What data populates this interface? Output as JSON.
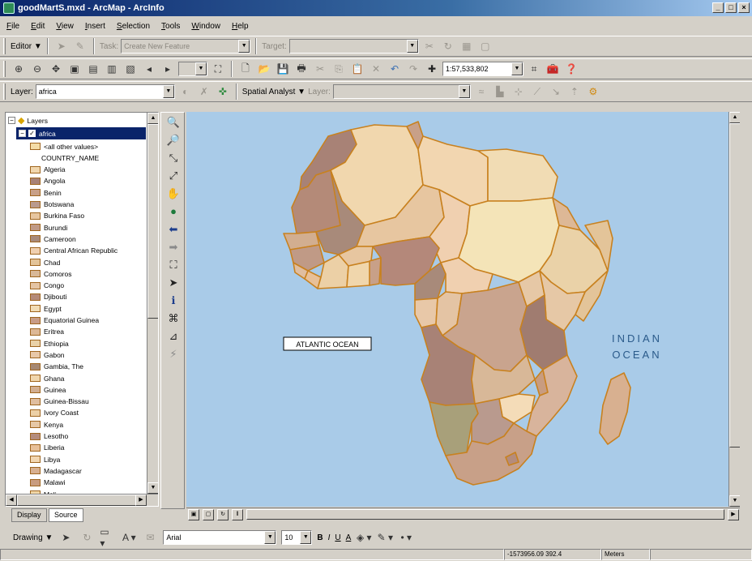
{
  "window": {
    "title": "goodMartS.mxd - ArcMap - ArcInfo",
    "controls": [
      "_",
      "□",
      "×"
    ]
  },
  "menu": [
    "File",
    "Edit",
    "View",
    "Insert",
    "Selection",
    "Tools",
    "Window",
    "Help"
  ],
  "editor_toolbar": {
    "editor_label": "Editor ▼",
    "task_label": "Task:",
    "task_value": "Create New Feature",
    "target_label": "Target:",
    "target_value": ""
  },
  "standard_toolbar": {
    "scale_value": "1:57,533,802"
  },
  "layer_toolbar": {
    "layer_label": "Layer:",
    "layer_value": "africa",
    "spatial_analyst": "Spatial Analyst ▼",
    "layer2_label": "Layer:"
  },
  "toc": {
    "root": "Layers",
    "layer": "africa",
    "legend_items": [
      {
        "label": "<all other values>",
        "color": "#f4dca6"
      },
      {
        "label": "COUNTRY_NAME",
        "color": ""
      },
      {
        "label": "Algeria",
        "color": "#f1d7ae"
      },
      {
        "label": "Angola",
        "color": "#a88276"
      },
      {
        "label": "Benin",
        "color": "#c8a088"
      },
      {
        "label": "Botswana",
        "color": "#b99a8e"
      },
      {
        "label": "Burkina Faso",
        "color": "#e7c6a0"
      },
      {
        "label": "Burundi",
        "color": "#c09a86"
      },
      {
        "label": "Cameroon",
        "color": "#a88a7a"
      },
      {
        "label": "Central African Republic",
        "color": "#f0d0b0"
      },
      {
        "label": "Chad",
        "color": "#e3c499"
      },
      {
        "label": "Comoros",
        "color": "#d8b898"
      },
      {
        "label": "Congo",
        "color": "#e4c4a4"
      },
      {
        "label": "Djibouti",
        "color": "#b48a78"
      },
      {
        "label": "Egypt",
        "color": "#f1dcb4"
      },
      {
        "label": "Equatorial Guinea",
        "color": "#c89c86"
      },
      {
        "label": "Eritrea",
        "color": "#ddb896"
      },
      {
        "label": "Ethiopia",
        "color": "#ead2a8"
      },
      {
        "label": "Gabon",
        "color": "#e8c8a8"
      },
      {
        "label": "Gambia, The",
        "color": "#a68872"
      },
      {
        "label": "Ghana",
        "color": "#f0d6ac"
      },
      {
        "label": "Guinea",
        "color": "#d2ae90"
      },
      {
        "label": "Guinea-Bissau",
        "color": "#e0bea0"
      },
      {
        "label": "Ivory Coast",
        "color": "#ecd0a6"
      },
      {
        "label": "Kenya",
        "color": "#e6c8a6"
      },
      {
        "label": "Lesotho",
        "color": "#b48c7c"
      },
      {
        "label": "Liberia",
        "color": "#e8c098"
      },
      {
        "label": "Libya",
        "color": "#f2d6b0"
      },
      {
        "label": "Madagascar",
        "color": "#d8b090"
      },
      {
        "label": "Malawi",
        "color": "#c89c80"
      },
      {
        "label": "Mali",
        "color": "#f0d6a6"
      }
    ],
    "tab_display": "Display",
    "tab_source": "Source"
  },
  "map": {
    "ocean_color": "#a9cbe8",
    "outline_color": "#c8811f",
    "atlantic_label": "ATLANTIC OCEAN",
    "indian_label_1": "INDIAN",
    "indian_label_2": "OCEAN"
  },
  "draw_toolbar": {
    "drawing_label": "Drawing ▼",
    "font_value": "Arial",
    "size_value": "10",
    "bold": "B",
    "italic": "I",
    "underline": "U",
    "font_color": "A"
  },
  "status": {
    "coords": "-1573956.09  392.4",
    "units": "Meters"
  }
}
